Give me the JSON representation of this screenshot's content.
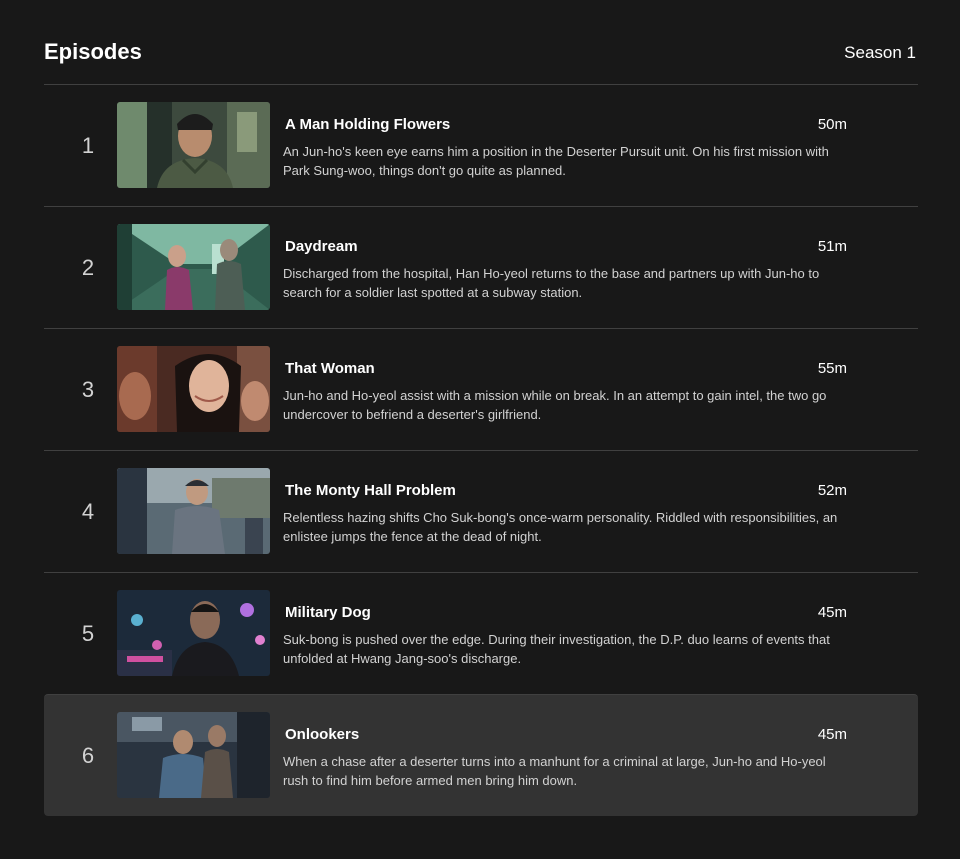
{
  "header": {
    "title": "Episodes",
    "season": "Season 1"
  },
  "episodes": [
    {
      "index": "1",
      "title": "A Man Holding Flowers",
      "duration": "50m",
      "synopsis": "An Jun-ho's keen eye earns him a position in the Deserter Pursuit unit. On his first mission with Park Sung-woo, things don't go quite as planned."
    },
    {
      "index": "2",
      "title": "Daydream",
      "duration": "51m",
      "synopsis": "Discharged from the hospital, Han Ho-yeol returns to the base and partners up with Jun-ho to search for a soldier last spotted at a subway station."
    },
    {
      "index": "3",
      "title": "That Woman",
      "duration": "55m",
      "synopsis": "Jun-ho and Ho-yeol assist with a mission while on break. In an attempt to gain intel, the two go undercover to befriend a deserter's girlfriend."
    },
    {
      "index": "4",
      "title": "The Monty Hall Problem",
      "duration": "52m",
      "synopsis": "Relentless hazing shifts Cho Suk-bong's once-warm personality. Riddled with responsibilities, an enlistee jumps the fence at the dead of night."
    },
    {
      "index": "5",
      "title": "Military Dog",
      "duration": "45m",
      "synopsis": "Suk-bong is pushed over the edge. During their investigation, the D.P. duo learns of events that unfolded at Hwang Jang-soo's discharge."
    },
    {
      "index": "6",
      "title": "Onlookers",
      "duration": "45m",
      "synopsis": "When a chase after a deserter turns into a manhunt for a criminal at large, Jun-ho and Ho-yeol rush to find him before armed men bring him down."
    }
  ]
}
